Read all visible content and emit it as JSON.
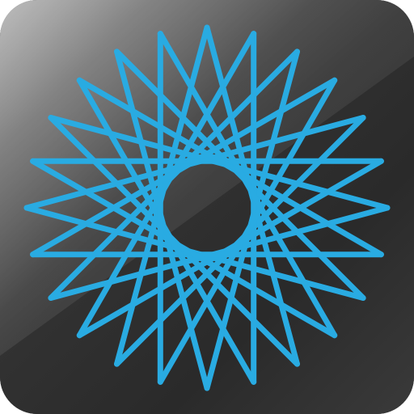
{
  "icon": {
    "name": "star-polygon-app-icon",
    "glyph": "dodecagram",
    "colors": {
      "stroke": "#29abe2",
      "background_dark": "#262626",
      "background_mid": "#3a3a3a",
      "background_light": "#8a8a8a",
      "gloss": "#ffffff"
    }
  }
}
